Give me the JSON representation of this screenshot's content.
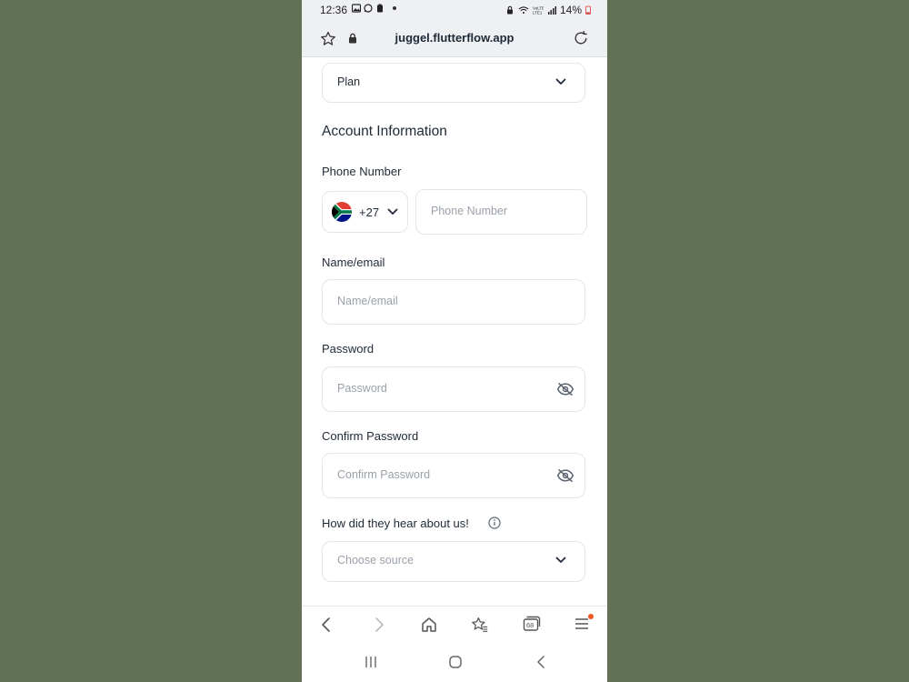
{
  "status_bar": {
    "time": "12:36",
    "battery": "14%",
    "icons": [
      "image-icon",
      "whatsapp-icon",
      "clipboard-icon",
      "notification-dot",
      "lock-icon",
      "wifi-icon",
      "volte-icon",
      "signal-icon",
      "battery-icon"
    ]
  },
  "browser": {
    "url": "juggel.flutterflow.app",
    "icons": [
      "star-icon",
      "lock-icon",
      "reload-icon"
    ]
  },
  "form": {
    "plan_value": "Plan",
    "section_title": "Account Information",
    "phone_label": "Phone Number",
    "country_code": "+27",
    "phone_placeholder": "Phone Number",
    "name_label": "Name/email",
    "name_placeholder": "Name/email",
    "password_label": "Password",
    "password_placeholder": "Password",
    "confirm_label": "Confirm Password",
    "confirm_placeholder": "Confirm Password",
    "source_label": "How did they hear about us!",
    "source_placeholder": "Choose source"
  },
  "bottom_nav": {
    "tabs_count": "68",
    "icons": [
      "back-icon",
      "forward-icon",
      "home-icon",
      "bookmarks-icon",
      "tabs-icon",
      "menu-icon"
    ]
  },
  "colors": {
    "background": "#627153",
    "accent_dot": "#f05a1f",
    "border": "#e2e6ea",
    "placeholder": "#9aa1aa"
  }
}
